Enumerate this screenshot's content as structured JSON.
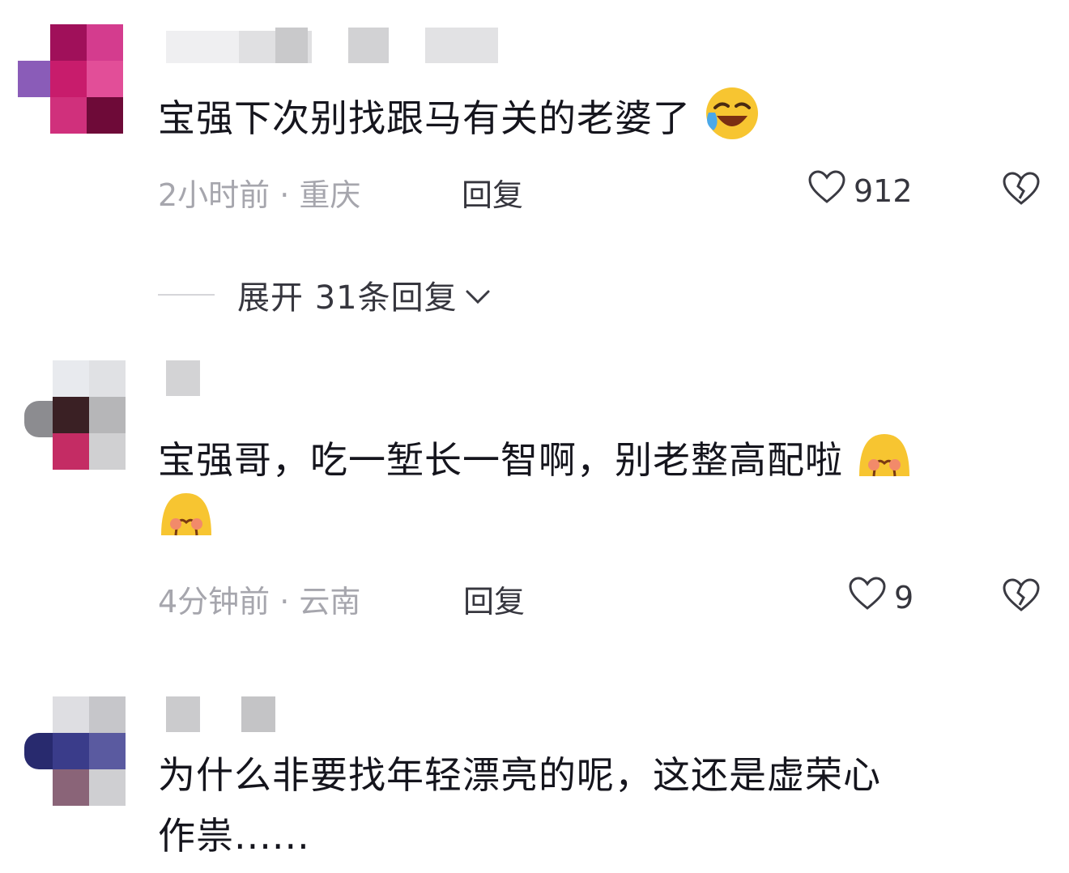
{
  "comments": [
    {
      "text": "宝强下次别找跟马有关的老婆了",
      "time_location": "2小时前 · 重庆",
      "reply_label": "回复",
      "likes": "912"
    },
    {
      "text_line1": "宝强哥，吃一堑长一智啊，别老整高配啦",
      "time_location": "4分钟前 · 云南",
      "reply_label": "回复",
      "likes": "9"
    },
    {
      "text_line1": "为什么非要找年轻漂亮的呢，这还是虚荣心",
      "text_line2": "作祟......"
    }
  ],
  "expand_replies": {
    "label": "展开 31条回复"
  },
  "colors": {
    "text": "#15151d",
    "meta": "#a6a6ad",
    "emoji_yellow": "#f7c531"
  },
  "icons": [
    "heart-icon",
    "broken-heart-icon",
    "chevron-down-icon",
    "laugh-cry-emoji",
    "shy-emoji"
  ]
}
